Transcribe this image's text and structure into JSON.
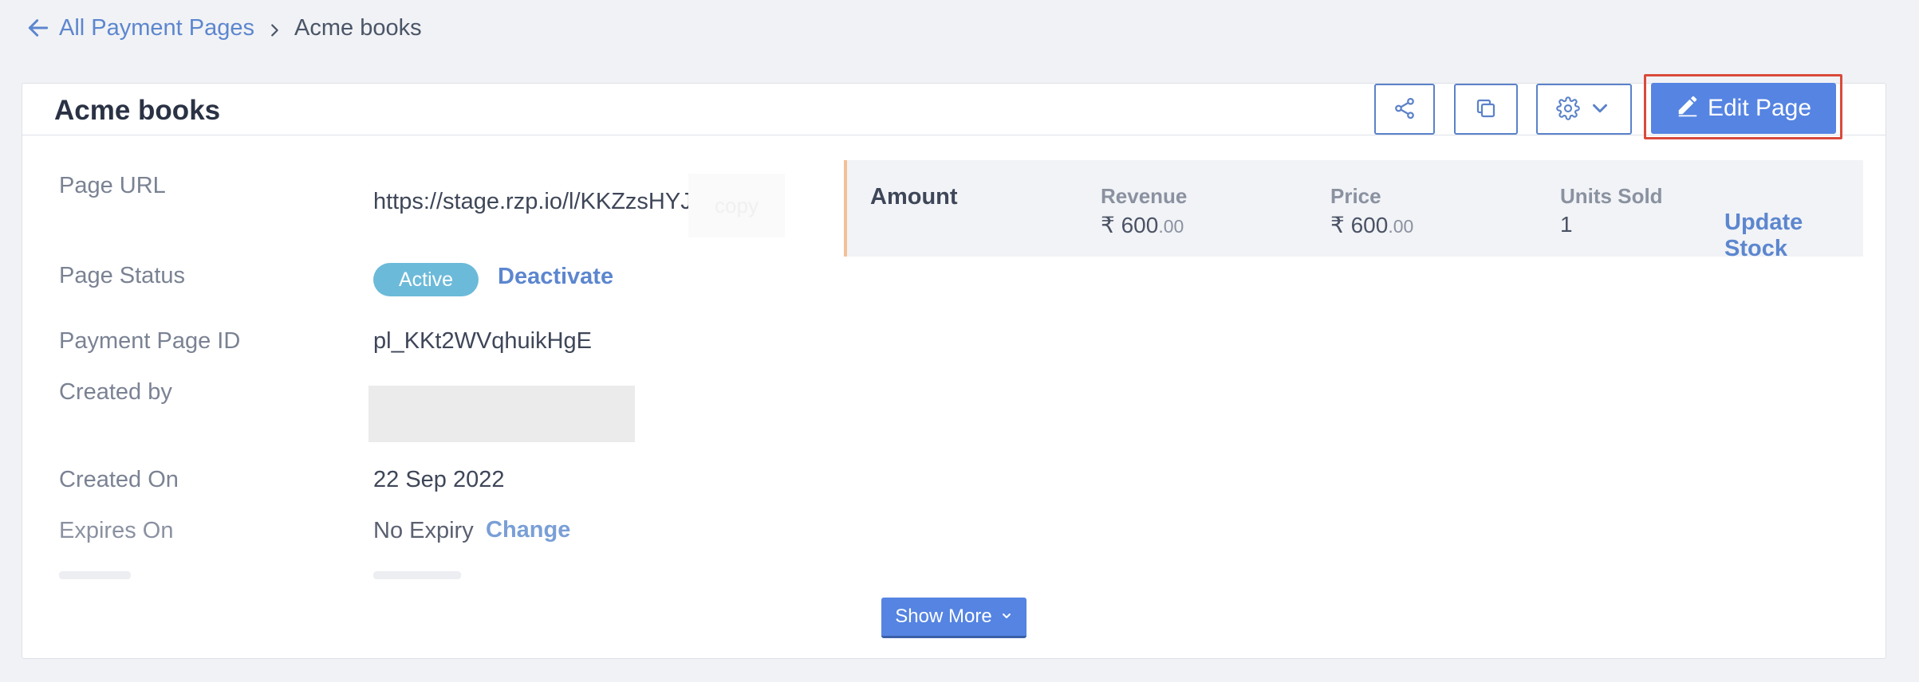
{
  "breadcrumb": {
    "back_label": "All Payment Pages",
    "current": "Acme books",
    "back_icon": "arrow-left-icon",
    "separator_icon": "chevron-right-icon"
  },
  "header": {
    "title": "Acme books",
    "share_icon": "share-icon",
    "copy_icon": "duplicate-icon",
    "settings_icon": "gear-icon",
    "edit_label": "Edit Page"
  },
  "details": {
    "page_url_label": "Page URL",
    "page_url_value": "https://stage.rzp.io/l/KKZzsHYJ",
    "copy_label": "copy",
    "page_status_label": "Page Status",
    "page_status_value": "Active",
    "deactivate_label": "Deactivate",
    "page_id_label": "Payment Page ID",
    "page_id_value": "pl_KKt2WVqhuikHgE",
    "created_by_label": "Created by",
    "created_on_label": "Created On",
    "created_on_value": "22 Sep 2022",
    "expires_label": "Expires On",
    "expires_value": "No Expiry",
    "change_label": "Change"
  },
  "stats": {
    "title": "Amount",
    "revenue_label": "Revenue",
    "revenue_currency": "₹",
    "revenue_int": "600",
    "revenue_dec": ".00",
    "price_label": "Price",
    "price_currency": "₹",
    "price_int": "600",
    "price_dec": ".00",
    "units_label": "Units Sold",
    "units_value": "1",
    "update_stock_label": "Update Stock"
  },
  "footer": {
    "show_more_label": "Show More"
  },
  "colors": {
    "accent": "#5584e2",
    "link": "#5c86cf",
    "badge_active": "#6cbad9",
    "highlight_outline": "#d94a3b",
    "stats_border": "#f3c197"
  }
}
